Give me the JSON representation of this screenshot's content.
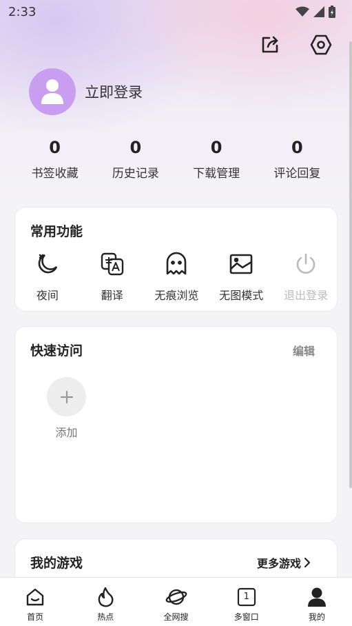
{
  "status": {
    "time": "2:33"
  },
  "profile": {
    "login_label": "立即登录"
  },
  "stats": [
    {
      "value": "0",
      "label": "书签收藏"
    },
    {
      "value": "0",
      "label": "历史记录"
    },
    {
      "value": "0",
      "label": "下载管理"
    },
    {
      "value": "0",
      "label": "评论回复"
    }
  ],
  "common_functions": {
    "title": "常用功能",
    "items": [
      {
        "label": "夜间",
        "icon": "moon-icon"
      },
      {
        "label": "翻译",
        "icon": "translate-icon"
      },
      {
        "label": "无痕浏览",
        "icon": "ghost-icon"
      },
      {
        "label": "无图模式",
        "icon": "image-icon"
      },
      {
        "label": "退出登录",
        "icon": "power-icon"
      }
    ]
  },
  "quick_access": {
    "title": "快速访问",
    "edit_label": "编辑",
    "add_label": "添加"
  },
  "games": {
    "title": "我的游戏",
    "more_label": "更多游戏"
  },
  "bottom_nav": [
    {
      "label": "首页",
      "icon": "home-icon"
    },
    {
      "label": "热点",
      "icon": "flame-icon"
    },
    {
      "label": "全网搜",
      "icon": "planet-icon"
    },
    {
      "label": "多窗口",
      "icon": "window-count-icon",
      "count": "1"
    },
    {
      "label": "我的",
      "icon": "profile-icon"
    }
  ],
  "colors": {
    "avatar": "#c99ef0",
    "disabled_text": "#bbbbbb"
  }
}
